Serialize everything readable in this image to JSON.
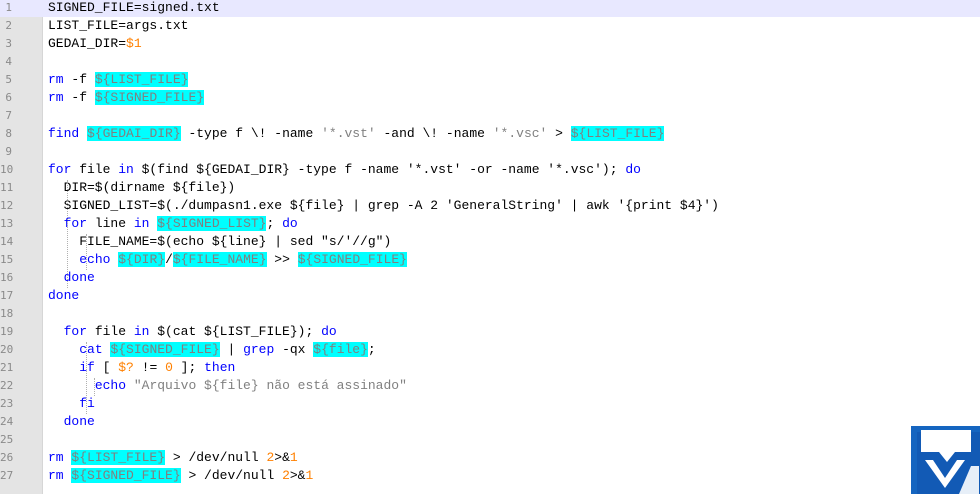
{
  "editor": {
    "colors": {
      "keyword": "#0000ff",
      "variable_highlight": "#00ffff",
      "variable_text": "#808080",
      "string": "#808080",
      "number": "#ff8000",
      "current_line": "#e8e8ff",
      "gutter": "#e4e4e4"
    },
    "current_line": 1,
    "lines": [
      {
        "n": "1",
        "parts": [
          {
            "t": "SIGNED_FILE=signed.txt"
          }
        ]
      },
      {
        "n": "2",
        "parts": [
          {
            "t": "LIST_FILE=args.txt"
          }
        ]
      },
      {
        "n": "3",
        "parts": [
          {
            "t": "GEDAI_DIR="
          },
          {
            "t": "$1",
            "c": "num"
          }
        ]
      },
      {
        "n": "4",
        "parts": []
      },
      {
        "n": "5",
        "parts": [
          {
            "t": "rm",
            "c": "kw"
          },
          {
            "t": " -f "
          },
          {
            "t": "${LIST_FILE}",
            "c": "var"
          }
        ]
      },
      {
        "n": "6",
        "parts": [
          {
            "t": "rm",
            "c": "kw"
          },
          {
            "t": " -f "
          },
          {
            "t": "${SIGNED_FILE}",
            "c": "var"
          }
        ]
      },
      {
        "n": "7",
        "parts": []
      },
      {
        "n": "8",
        "parts": [
          {
            "t": "find",
            "c": "kw"
          },
          {
            "t": " "
          },
          {
            "t": "${GEDAI_DIR}",
            "c": "var"
          },
          {
            "t": " -type f \\! -name "
          },
          {
            "t": "'*.vst'",
            "c": "str"
          },
          {
            "t": " -and \\! -name "
          },
          {
            "t": "'*.vsc'",
            "c": "str"
          },
          {
            "t": " > "
          },
          {
            "t": "${LIST_FILE}",
            "c": "var"
          }
        ]
      },
      {
        "n": "9",
        "parts": []
      },
      {
        "n": "10",
        "parts": [
          {
            "t": "for",
            "c": "kw"
          },
          {
            "t": " file "
          },
          {
            "t": "in",
            "c": "kw"
          },
          {
            "t": " $(find ${GEDAI_DIR} -type f -name '*.vst' -or -name '*.vsc'); "
          },
          {
            "t": "do",
            "c": "kw"
          }
        ]
      },
      {
        "n": "11",
        "parts": [
          {
            "t": "  DIR=$(dirname ${file})"
          }
        ]
      },
      {
        "n": "12",
        "parts": [
          {
            "t": "  SIGNED_LIST=$(./dumpasn1.exe ${file} | grep -A 2 'GeneralString' | awk '{print $4}')"
          }
        ]
      },
      {
        "n": "13",
        "parts": [
          {
            "t": "  "
          },
          {
            "t": "for",
            "c": "kw"
          },
          {
            "t": " line "
          },
          {
            "t": "in",
            "c": "kw"
          },
          {
            "t": " "
          },
          {
            "t": "${SIGNED_LIST}",
            "c": "var"
          },
          {
            "t": "; "
          },
          {
            "t": "do",
            "c": "kw"
          }
        ]
      },
      {
        "n": "14",
        "parts": [
          {
            "t": "    FILE_NAME=$(echo ${line} | sed \"s/'//g\")"
          }
        ]
      },
      {
        "n": "15",
        "parts": [
          {
            "t": "    "
          },
          {
            "t": "echo",
            "c": "kw"
          },
          {
            "t": " "
          },
          {
            "t": "${DIR}",
            "c": "var"
          },
          {
            "t": "/"
          },
          {
            "t": "${FILE_NAME}",
            "c": "var"
          },
          {
            "t": " >> "
          },
          {
            "t": "${SIGNED_FILE}",
            "c": "var"
          }
        ]
      },
      {
        "n": "16",
        "parts": [
          {
            "t": "  "
          },
          {
            "t": "done",
            "c": "kw"
          }
        ]
      },
      {
        "n": "17",
        "parts": [
          {
            "t": "done",
            "c": "kw"
          }
        ]
      },
      {
        "n": "18",
        "parts": []
      },
      {
        "n": "19",
        "parts": [
          {
            "t": "  "
          },
          {
            "t": "for",
            "c": "kw"
          },
          {
            "t": " file "
          },
          {
            "t": "in",
            "c": "kw"
          },
          {
            "t": " $(cat ${LIST_FILE}); "
          },
          {
            "t": "do",
            "c": "kw"
          }
        ]
      },
      {
        "n": "20",
        "parts": [
          {
            "t": "    "
          },
          {
            "t": "cat",
            "c": "kw"
          },
          {
            "t": " "
          },
          {
            "t": "${SIGNED_FILE}",
            "c": "var"
          },
          {
            "t": " | "
          },
          {
            "t": "grep",
            "c": "kw"
          },
          {
            "t": " -qx "
          },
          {
            "t": "${file}",
            "c": "var"
          },
          {
            "t": ";"
          }
        ]
      },
      {
        "n": "21",
        "parts": [
          {
            "t": "    "
          },
          {
            "t": "if",
            "c": "kw"
          },
          {
            "t": " [ "
          },
          {
            "t": "$?",
            "c": "num"
          },
          {
            "t": " != "
          },
          {
            "t": "0",
            "c": "num"
          },
          {
            "t": " ]; "
          },
          {
            "t": "then",
            "c": "kw"
          }
        ]
      },
      {
        "n": "22",
        "parts": [
          {
            "t": "      "
          },
          {
            "t": "echo",
            "c": "kw"
          },
          {
            "t": " "
          },
          {
            "t": "\"Arquivo ${file} não está assinado\"",
            "c": "str"
          }
        ]
      },
      {
        "n": "23",
        "parts": [
          {
            "t": "    "
          },
          {
            "t": "fi",
            "c": "kw"
          }
        ]
      },
      {
        "n": "24",
        "parts": [
          {
            "t": "  "
          },
          {
            "t": "done",
            "c": "kw"
          }
        ]
      },
      {
        "n": "25",
        "parts": []
      },
      {
        "n": "26",
        "parts": [
          {
            "t": "rm",
            "c": "kw"
          },
          {
            "t": " "
          },
          {
            "t": "${LIST_FILE}",
            "c": "var"
          },
          {
            "t": " > /dev/null "
          },
          {
            "t": "2",
            "c": "num"
          },
          {
            "t": ">&"
          },
          {
            "t": "1",
            "c": "num"
          }
        ]
      },
      {
        "n": "27",
        "parts": [
          {
            "t": "rm",
            "c": "kw"
          },
          {
            "t": " "
          },
          {
            "t": "${SIGNED_FILE}",
            "c": "var"
          },
          {
            "t": " > /dev/null "
          },
          {
            "t": "2",
            "c": "num"
          },
          {
            "t": ">&"
          },
          {
            "t": "1",
            "c": "num"
          }
        ]
      }
    ]
  },
  "watermark": {
    "icon": "logo-icon",
    "color": "#1565c0"
  }
}
